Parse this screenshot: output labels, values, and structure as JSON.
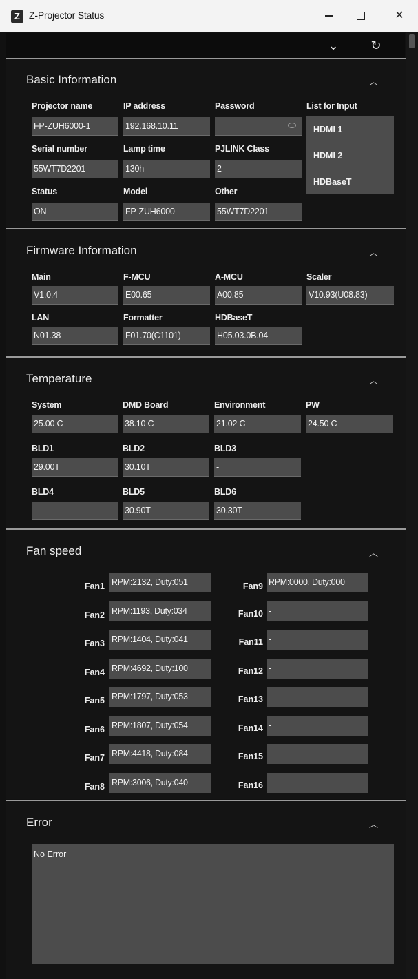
{
  "window": {
    "app_icon": "Z",
    "title": "Z-Projector Status",
    "minimize": "",
    "maximize": "",
    "close": "✕"
  },
  "toolbar": {
    "collapse_all_icon": "⌄",
    "refresh_icon": "↻"
  },
  "basic": {
    "title": "Basic Information",
    "projector_name_label": "Projector name",
    "projector_name": "FP-ZUH6000-1",
    "ip_label": "IP address",
    "ip": "192.168.10.11",
    "password_label": "Password",
    "password": "",
    "list_input_label": "List for Input",
    "inputs": [
      "HDMI 1",
      "HDMI 2",
      "HDBaseT"
    ],
    "serial_label": "Serial number",
    "serial": "55WT7D2201",
    "lamp_label": "Lamp time",
    "lamp": "130h",
    "pjlink_label": "PJLINK Class",
    "pjlink": "2",
    "status_label": "Status",
    "status": "ON",
    "model_label": "Model",
    "model": "FP-ZUH6000",
    "other_label": "Other",
    "other": "55WT7D2201"
  },
  "firmware": {
    "title": "Firmware Information",
    "main_label": "Main",
    "main": "V1.0.4",
    "fmcu_label": "F-MCU",
    "fmcu": "E00.65",
    "amcu_label": "A-MCU",
    "amcu": "A00.85",
    "scaler_label": "Scaler",
    "scaler": "V10.93(U08.83)",
    "lan_label": "LAN",
    "lan": "N01.38",
    "formatter_label": "Formatter",
    "formatter": "F01.70(C1101)",
    "hdbaset_label": "HDBaseT",
    "hdbaset": "H05.03.0B.04"
  },
  "temperature": {
    "title": "Temperature",
    "system_label": "System",
    "system": "25.00 C",
    "dmd_label": "DMD Board",
    "dmd": "38.10 C",
    "env_label": "Environment",
    "env": "21.02 C",
    "pw_label": "PW",
    "pw": "24.50 C",
    "bld1_label": "BLD1",
    "bld1": "29.00T",
    "bld2_label": "BLD2",
    "bld2": "30.10T",
    "bld3_label": "BLD3",
    "bld3": "-",
    "bld4_label": "BLD4",
    "bld4": "-",
    "bld5_label": "BLD5",
    "bld5": "30.90T",
    "bld6_label": "BLD6",
    "bld6": "30.30T"
  },
  "fan": {
    "title": "Fan speed",
    "fans": [
      {
        "label": "Fan1",
        "value": "RPM:2132, Duty:051"
      },
      {
        "label": "Fan2",
        "value": "RPM:1193, Duty:034"
      },
      {
        "label": "Fan3",
        "value": "RPM:1404, Duty:041"
      },
      {
        "label": "Fan4",
        "value": "RPM:4692, Duty:100"
      },
      {
        "label": "Fan5",
        "value": "RPM:1797, Duty:053"
      },
      {
        "label": "Fan6",
        "value": "RPM:1807, Duty:054"
      },
      {
        "label": "Fan7",
        "value": "RPM:4418, Duty:084"
      },
      {
        "label": "Fan8",
        "value": "RPM:3006, Duty:040"
      },
      {
        "label": "Fan9",
        "value": "RPM:0000, Duty:000"
      },
      {
        "label": "Fan10",
        "value": "-"
      },
      {
        "label": "Fan11",
        "value": "-"
      },
      {
        "label": "Fan12",
        "value": "-"
      },
      {
        "label": "Fan13",
        "value": "-"
      },
      {
        "label": "Fan14",
        "value": "-"
      },
      {
        "label": "Fan15",
        "value": "-"
      },
      {
        "label": "Fan16",
        "value": "-"
      }
    ]
  },
  "error": {
    "title": "Error",
    "text": "No Error"
  },
  "caret_icon": "︿"
}
